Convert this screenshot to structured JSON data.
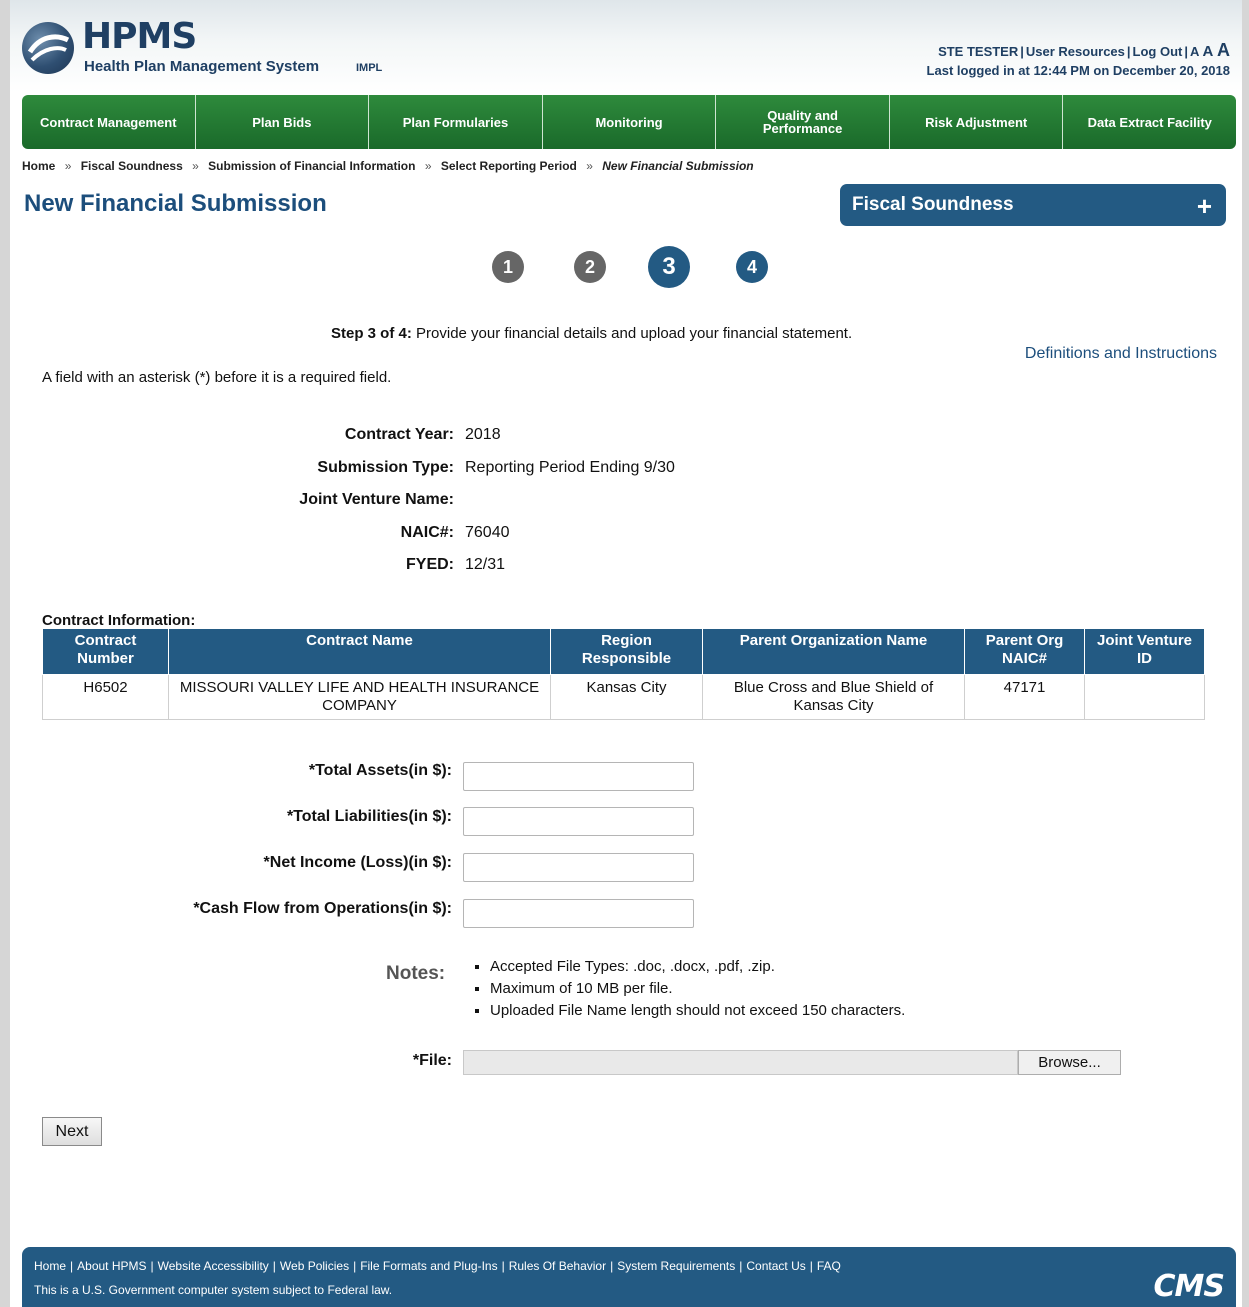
{
  "header": {
    "title": "HPMS",
    "subtitle": "Health Plan Management System",
    "env": "IMPL",
    "user": "STE TESTER",
    "user_resources": "User Resources",
    "logout": "Log Out",
    "font_small": "A",
    "font_med": "A",
    "font_large": "A",
    "last_logged": "Last logged in at 12:44 PM on December 20, 2018"
  },
  "nav": [
    "Contract Management",
    "Plan Bids",
    "Plan Formularies",
    "Monitoring",
    "Quality and Performance",
    "Risk Adjustment",
    "Data Extract Facility"
  ],
  "breadcrumb": {
    "items": [
      "Home",
      "Fiscal Soundness",
      "Submission of Financial Information",
      "Select Reporting Period"
    ],
    "current": "New Financial Submission",
    "separator": "»"
  },
  "page_title": "New Financial Submission",
  "fs_box": {
    "label": "Fiscal Soundness",
    "plus": "+"
  },
  "steps": [
    "1",
    "2",
    "3",
    "4"
  ],
  "step_text": {
    "bold": "Step 3 of 4:",
    "rest": " Provide your financial details and upload your financial statement."
  },
  "definitions_link": "Definitions and Instructions",
  "asterisk_note": "A field with an asterisk (*) before it is a required field.",
  "info": [
    {
      "label": "Contract Year:",
      "value": "2018"
    },
    {
      "label": "Submission Type:",
      "value": "Reporting Period Ending 9/30"
    },
    {
      "label": "Joint Venture Name:",
      "value": ""
    },
    {
      "label": "NAIC#:",
      "value": "76040"
    },
    {
      "label": "FYED:",
      "value": "12/31"
    }
  ],
  "contract_info": {
    "label": "Contract Information:",
    "headers": [
      "Contract Number",
      "Contract Name",
      "Region Responsible",
      "Parent Organization Name",
      "Parent Org NAIC#",
      "Joint Venture ID"
    ],
    "rows": [
      [
        "H6502",
        "MISSOURI VALLEY LIFE AND HEALTH INSURANCE COMPANY",
        "Kansas City",
        "Blue Cross and Blue Shield of Kansas City",
        "47171",
        ""
      ]
    ]
  },
  "form": {
    "total_assets": "*Total Assets(in $):",
    "total_liabilities": "*Total Liabilities(in $):",
    "net_income": "*Net Income (Loss)(in $):",
    "cash_flow": "*Cash Flow from Operations(in $):"
  },
  "notes": {
    "label": "Notes:",
    "items": [
      "Accepted File Types: .doc, .docx, .pdf, .zip.",
      "Maximum of 10 MB per file.",
      "Uploaded File Name length should not exceed 150 characters."
    ]
  },
  "file": {
    "label": "*File:",
    "browse": "Browse..."
  },
  "next_button": "Next",
  "footer": {
    "links": [
      "Home",
      "About HPMS",
      "Website Accessibility",
      "Web Policies",
      "File Formats and Plug-Ins",
      "Rules Of Behavior",
      "System Requirements",
      "Contact Us",
      "FAQ"
    ],
    "note": "This is a U.S. Government computer system subject to Federal law.",
    "logo": "CMS"
  },
  "colors": {
    "brand_blue": "#235a83",
    "nav_green": "#1f7a31",
    "title_blue": "#1c4e7c"
  }
}
